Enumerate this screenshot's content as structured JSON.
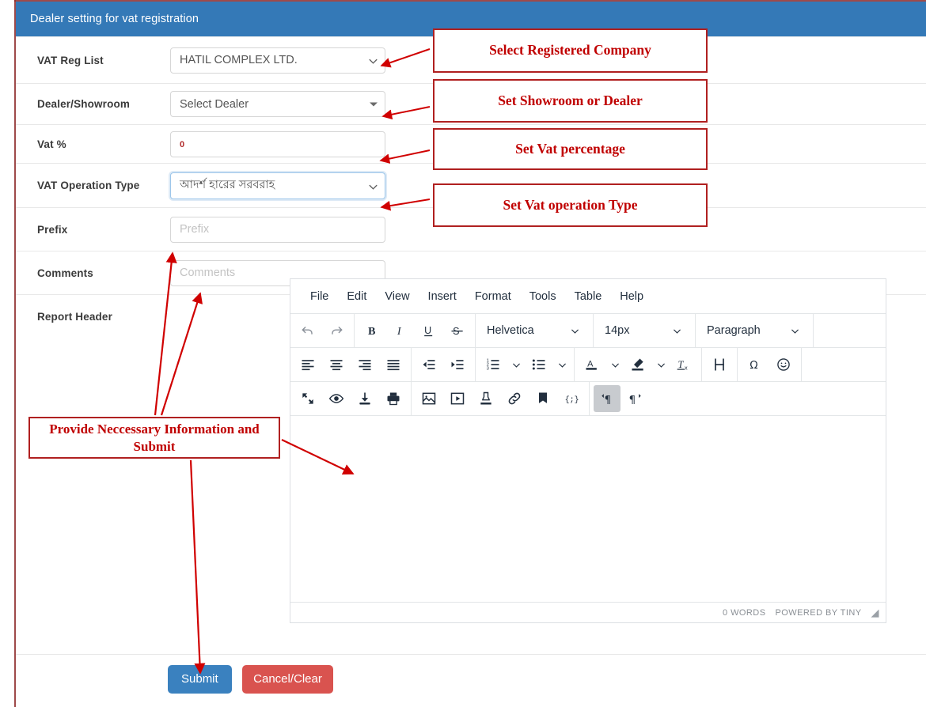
{
  "panel": {
    "title": "Dealer setting for vat registration"
  },
  "form": {
    "rows": [
      {
        "label": "VAT Reg List",
        "value": "HATIL COMPLEX LTD.",
        "control": "select"
      },
      {
        "label": "Dealer/Showroom",
        "value": "Select Dealer",
        "control": "select"
      },
      {
        "label": "Vat %",
        "value": "0",
        "control": "text"
      },
      {
        "label": "VAT Operation Type",
        "value": "আদর্শ হারের সরবরাহ",
        "control": "select"
      },
      {
        "label": "Prefix",
        "placeholder": "Prefix",
        "value": "",
        "control": "text"
      },
      {
        "label": "Comments",
        "placeholder": "Comments",
        "value": "",
        "control": "text"
      },
      {
        "label": "Report Header",
        "control": "richtext"
      }
    ]
  },
  "editor": {
    "menu": [
      "File",
      "Edit",
      "View",
      "Insert",
      "Format",
      "Tools",
      "Table",
      "Help"
    ],
    "font_family": "Helvetica",
    "font_size": "14px",
    "block_format": "Paragraph",
    "toolbar_row1_icons": [
      "undo-icon",
      "redo-icon",
      "bold-icon",
      "italic-icon",
      "underline-icon",
      "strikethrough-icon"
    ],
    "toolbar_row2_icons": [
      "align-left-icon",
      "align-center-icon",
      "align-right-icon",
      "align-justify-icon",
      "outdent-icon",
      "indent-icon",
      "numbered-list-icon",
      "bullet-list-icon",
      "text-color-icon",
      "highlight-color-icon",
      "clear-formatting-icon",
      "page-break-icon",
      "special-character-icon",
      "emoticon-icon"
    ],
    "toolbar_row3_icons": [
      "fullscreen-icon",
      "preview-icon",
      "save-icon",
      "print-icon",
      "insert-image-icon",
      "insert-media-icon",
      "template-icon",
      "insert-link-icon",
      "anchor-icon",
      "source-code-icon",
      "ltr-icon",
      "rtl-icon"
    ],
    "content": "",
    "status_words": "0 WORDS",
    "status_branding": "POWERED BY TINY"
  },
  "actions": {
    "submit_label": "Submit",
    "cancel_label": "Cancel/Clear"
  },
  "annotations": [
    {
      "id": "co-1",
      "text": "Select Registered Company"
    },
    {
      "id": "co-2",
      "text": "Set Showroom or Dealer"
    },
    {
      "id": "co-3",
      "text": "Set Vat percentage"
    },
    {
      "id": "co-4",
      "text": "Set Vat operation Type"
    },
    {
      "id": "co-5",
      "text": "Provide Neccessary Information and Submit"
    }
  ],
  "colors": {
    "header_blue": "#3479b7",
    "annotation_red": "#c00000",
    "annotation_border": "#b02020",
    "submit_blue": "#3a81bf",
    "cancel_red": "#d9534f"
  }
}
